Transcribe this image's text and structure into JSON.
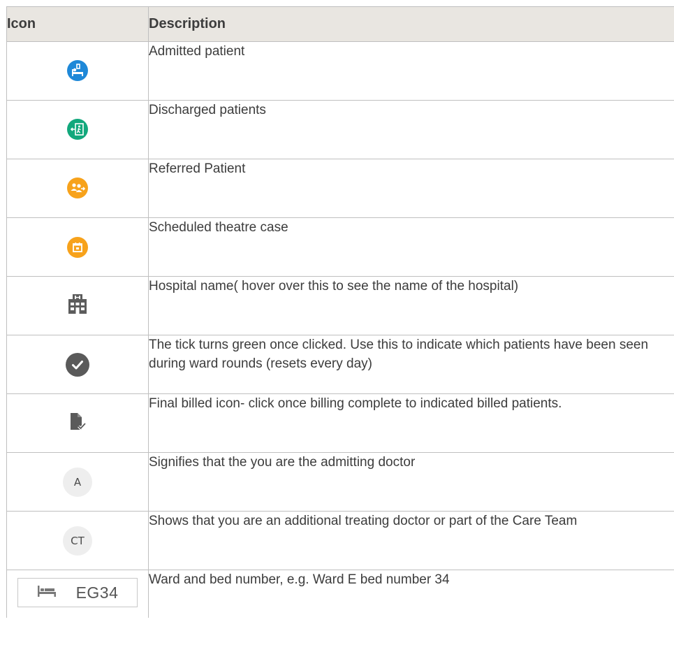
{
  "header": {
    "icon": "Icon",
    "description": "Description"
  },
  "colors": {
    "admitted": "#1e88d8",
    "discharged": "#12a87c",
    "referred": "#f7a21b",
    "scheduled": "#f7a21b",
    "neutral": "#555555"
  },
  "rows": [
    {
      "icon_name": "admitted-patient-icon",
      "description": "Admitted patient"
    },
    {
      "icon_name": "discharged-patient-icon",
      "description": "Discharged patients"
    },
    {
      "icon_name": "referred-patient-icon",
      "description": "Referred Patient"
    },
    {
      "icon_name": "scheduled-theatre-icon",
      "description": "Scheduled theatre case"
    },
    {
      "icon_name": "hospital-icon",
      "description": "Hospital name( hover over this to see the name of the hospital)"
    },
    {
      "icon_name": "tick-icon",
      "description": "The tick turns green once clicked.  Use this to indicate which patients have been seen during ward rounds (resets every day)"
    },
    {
      "icon_name": "final-billed-icon",
      "description": "Final billed icon- click once billing complete to indicated billed patients."
    },
    {
      "icon_name": "admitting-doctor-badge",
      "badge": "A",
      "description": "Signifies that the you are the admitting doctor"
    },
    {
      "icon_name": "care-team-badge",
      "badge": "CT",
      "description": "Shows that you are an additional treating doctor or part of the Care Team"
    },
    {
      "icon_name": "bed-icon",
      "ward_label": "EG34",
      "description": "Ward and bed number, e.g. Ward E bed number 34"
    }
  ]
}
